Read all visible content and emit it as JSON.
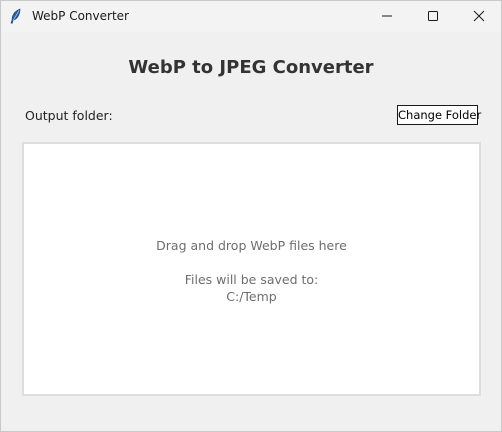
{
  "window": {
    "title": "WebP Converter",
    "icon": "feather-icon",
    "controls": [
      "minimize-icon",
      "maximize-icon",
      "close-icon"
    ]
  },
  "main": {
    "heading": "WebP to JPEG Converter",
    "output_label": "Output folder:",
    "change_folder_label": "Change Folder"
  },
  "drop_zone": {
    "instruction": "Drag and drop WebP files here",
    "saved_to_label": "Files will be saved to:",
    "folder_path": "C:/Temp"
  }
}
